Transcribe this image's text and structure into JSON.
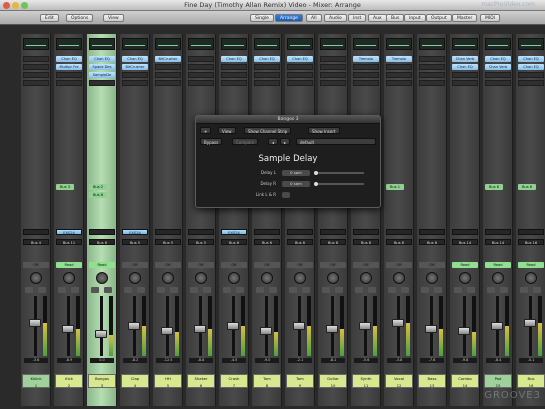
{
  "window": {
    "title": "Fine Day (Timothy Allan Remix) Video - Mixer: Arrange",
    "watermark": "macProVideo.com"
  },
  "toolbar": {
    "left_buttons": [
      "Edit",
      "Options",
      "View"
    ],
    "filter_buttons": [
      "Single",
      "Arrange",
      "All",
      "Audio",
      "Inst",
      "Aux",
      "Bus",
      "Input",
      "Output",
      "Master",
      "MIDI"
    ],
    "selected_filter": "Arrange"
  },
  "strips": [
    {
      "name": "Kklick",
      "number": "1",
      "color": "audio",
      "plugins": [],
      "input": "",
      "output": "Bus 4",
      "auto": "Off",
      "vol": "-3.6",
      "level": 0.55
    },
    {
      "name": "Kick",
      "number": "2",
      "color": "",
      "plugins": [
        "Chan EQ",
        "Multipr Fre"
      ],
      "send": "Bus 3",
      "input": "EXS24",
      "output": "Bus 11",
      "auto": "Read",
      "vol": "-8.9",
      "level": 0.45
    },
    {
      "name": "Bongos",
      "number": "3",
      "color": "",
      "selected": true,
      "plugins": [
        "Chan EQ",
        "Space Des",
        "SampleDe"
      ],
      "send": "Bus 2",
      "send2": "Bus 6",
      "input": "",
      "output": "Bus 6",
      "auto": "Read",
      "vol": "0.0",
      "level": 0.35
    },
    {
      "name": "Clap",
      "number": "4",
      "color": "",
      "plugins": [
        "Chan EQ",
        "BitCrusher"
      ],
      "send": "",
      "input": "EXS24",
      "output": "Bus 5",
      "auto": "Off",
      "vol": "-8.2",
      "level": 0.5
    },
    {
      "name": "HH",
      "number": "5",
      "color": "",
      "plugins": [
        "BitCrusher"
      ],
      "send": "",
      "input": "",
      "output": "Bus 5",
      "auto": "Off",
      "vol": "-12.5",
      "level": 0.4
    },
    {
      "name": "Shaker",
      "number": "6",
      "color": "",
      "plugins": [],
      "send": "",
      "input": "",
      "output": "Bus 5",
      "auto": "Off",
      "vol": "-8.8",
      "level": 0.45
    },
    {
      "name": "Crash",
      "number": "7",
      "color": "",
      "plugins": [
        "Chan EQ"
      ],
      "send": "",
      "input": "EXS24",
      "output": "Bus 6",
      "auto": "Off",
      "vol": "-4.5",
      "level": 0.5
    },
    {
      "name": "Tom",
      "number": "8",
      "color": "",
      "plugins": [
        "Chan EQ"
      ],
      "send": "",
      "input": "",
      "output": "Bus 6",
      "auto": "Off",
      "vol": "-9.0",
      "level": 0.4
    },
    {
      "name": "Tom",
      "number": "9",
      "color": "",
      "plugins": [
        "Chan EQ"
      ],
      "send": "",
      "input": "",
      "output": "Bus 6",
      "auto": "Off",
      "vol": "-2.1",
      "level": 0.5
    },
    {
      "name": "Guitar",
      "number": "10",
      "color": "",
      "plugins": [],
      "send": "",
      "input": "",
      "output": "Bus 8",
      "auto": "Off",
      "vol": "-8.1",
      "level": 0.45
    },
    {
      "name": "Synth",
      "number": "11",
      "color": "",
      "plugins": [
        "Tremolo"
      ],
      "send": "",
      "input": "",
      "output": "Bus 8",
      "auto": "Off",
      "vol": "-5.6",
      "level": 0.5
    },
    {
      "name": "Vocal",
      "number": "12",
      "color": "",
      "plugins": [
        "Tremolo"
      ],
      "send": "Bus 1",
      "input": "",
      "output": "Bus 8",
      "auto": "Off",
      "vol": "-3.8",
      "level": 0.55
    },
    {
      "name": "Bass",
      "number": "13",
      "color": "",
      "plugins": [],
      "send": "",
      "input": "",
      "output": "Bus 8",
      "auto": "Off",
      "vol": "-7.6",
      "level": 0.45
    },
    {
      "name": "Combo",
      "number": "14",
      "color": "",
      "plugins": [
        "Chan Verb",
        "Chan EQ"
      ],
      "send": "",
      "input": "",
      "output": "Bus 14",
      "auto": "Read",
      "vol": "-9.8",
      "level": 0.4
    },
    {
      "name": "Pad",
      "number": "15",
      "color": "audio",
      "plugins": [
        "Chan EQ",
        "Chan Verb"
      ],
      "send": "Bus 6",
      "input": "",
      "output": "Bus 14",
      "auto": "Read",
      "vol": "-8.4",
      "level": 0.5
    },
    {
      "name": "Bus",
      "number": "16",
      "color": "",
      "plugins": [
        "Chan EQ",
        "Chan EQ"
      ],
      "send": "Bus 6",
      "input": "",
      "output": "Bus 16",
      "auto": "Read",
      "vol": "-0.1",
      "level": 0.55
    }
  ],
  "plugin_window": {
    "title": "Bongos 3",
    "buttons": [
      "View",
      "Show Channel Strip",
      "Show Insert"
    ],
    "controls": [
      "Bypass",
      "Compare",
      "default"
    ],
    "plugin_name": "Sample Delay",
    "params": [
      {
        "label": "Delay L",
        "value": "0 sam"
      },
      {
        "label": "Delay R",
        "value": "0 sam"
      },
      {
        "label": "Link L & R",
        "value": ""
      }
    ]
  },
  "brand": "GROOVE3"
}
